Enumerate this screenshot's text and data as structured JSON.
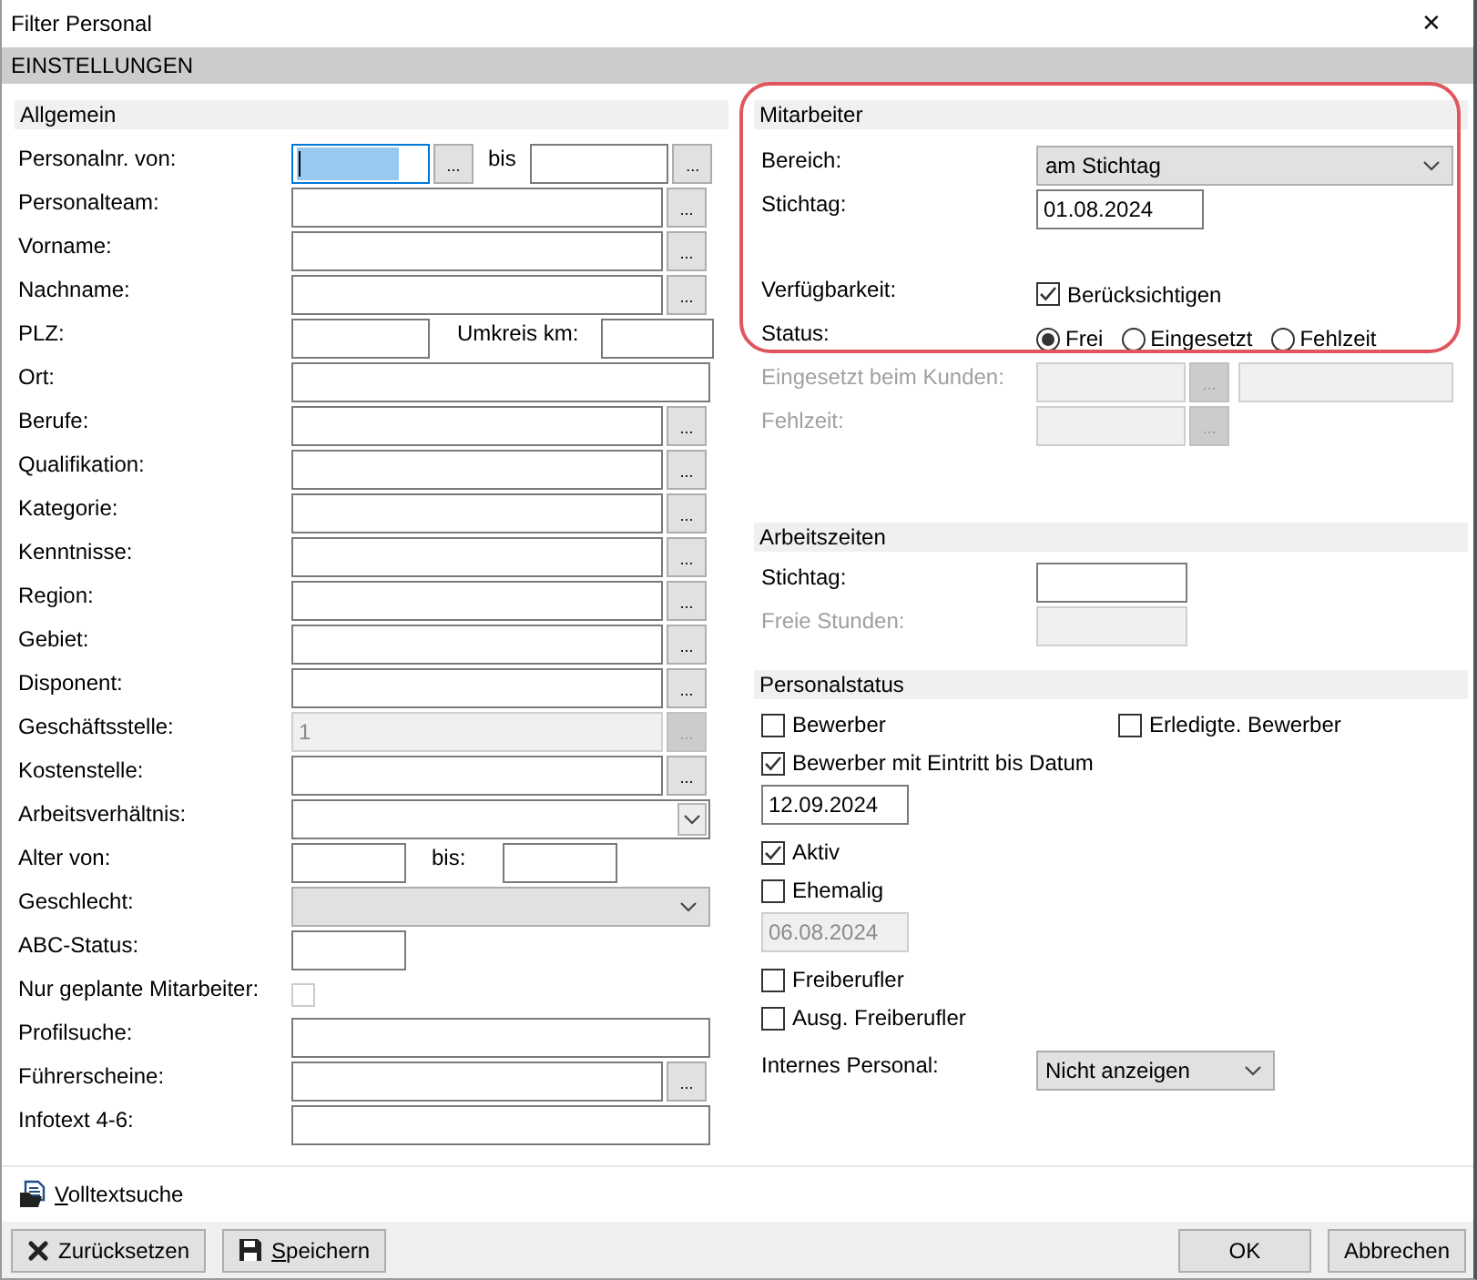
{
  "window": {
    "title": "Filter Personal",
    "close": "✕"
  },
  "header": "EINSTELLUNGEN",
  "allgemein": {
    "title": "Allgemein",
    "rows": [
      {
        "kind": "range",
        "label": "Personalnr. von:",
        "from": {
          "focused": true
        },
        "button": "...",
        "to_label": "bis",
        "to_button": "..."
      },
      {
        "kind": "lookup",
        "label": "Personalteam:",
        "button": "...",
        "disabled": false
      },
      {
        "kind": "lookup",
        "label": "Vorname:",
        "button": "...",
        "disabled": false
      },
      {
        "kind": "lookup",
        "label": "Nachname:",
        "button": "...",
        "disabled": false
      },
      {
        "kind": "pair",
        "label": "PLZ:",
        "mid_label": "Umkreis km:"
      },
      {
        "kind": "text",
        "label": "Ort:"
      },
      {
        "kind": "lookup",
        "label": "Berufe:",
        "button": "...",
        "disabled": false
      },
      {
        "kind": "lookup",
        "label": "Qualifikation:",
        "button": "...",
        "disabled": false
      },
      {
        "kind": "lookup",
        "label": "Kategorie:",
        "button": "...",
        "disabled": false
      },
      {
        "kind": "lookup",
        "label": "Kenntnisse:",
        "button": "...",
        "disabled": false
      },
      {
        "kind": "lookup",
        "label": "Region:",
        "button": "...",
        "disabled": false
      },
      {
        "kind": "lookup",
        "label": "Gebiet:",
        "button": "...",
        "disabled": false
      },
      {
        "kind": "lookup",
        "label": "Disponent:",
        "button": "...",
        "disabled": false
      },
      {
        "kind": "lookup",
        "label": "Geschäftsstelle:",
        "value": "1",
        "button": "...",
        "disabled": true
      },
      {
        "kind": "lookup",
        "label": "Kostenstelle:",
        "button": "...",
        "disabled": false
      },
      {
        "kind": "select",
        "label": "Arbeitsverhältnis:",
        "editable": true
      },
      {
        "kind": "age",
        "label": "Alter von:",
        "mid_label": "bis:"
      },
      {
        "kind": "select",
        "label": "Geschlecht:",
        "editable": false
      },
      {
        "kind": "short",
        "label": "ABC-Status:"
      },
      {
        "kind": "check",
        "label": "Nur geplante Mitarbeiter:",
        "checked": false,
        "disabled": true
      },
      {
        "kind": "text",
        "label": "Profilsuche:"
      },
      {
        "kind": "lookup",
        "label": "Führerscheine:",
        "button": "...",
        "disabled": false
      },
      {
        "kind": "text",
        "label": "Infotext 4-6:"
      }
    ]
  },
  "mitarbeiter": {
    "title": "Mitarbeiter",
    "highlighted": true,
    "rows": [
      {
        "kind": "select",
        "label": "Bereich:",
        "value": "am Stichtag",
        "editable": false
      },
      {
        "kind": "date",
        "label": "Stichtag:",
        "value": "01.08.2024",
        "disabled": false
      },
      {
        "kind": "check",
        "label": "Verfügbarkeit:",
        "text": "Berücksichtigen",
        "checked": true
      },
      {
        "kind": "radios",
        "label": "Status:",
        "options": [
          {
            "label": "Frei",
            "selected": true
          },
          {
            "label": "Eingesetzt",
            "selected": false
          },
          {
            "label": "Fehlzeit",
            "selected": false
          }
        ]
      },
      {
        "kind": "lookup2",
        "label": "Eingesetzt beim Kunden:",
        "button": "...",
        "disabled": true
      },
      {
        "kind": "lookup",
        "label": "Fehlzeit:",
        "button": "...",
        "disabled": true
      }
    ]
  },
  "arbeitszeiten": {
    "title": "Arbeitszeiten",
    "rows": [
      {
        "kind": "date",
        "label": "Stichtag:",
        "disabled": false
      },
      {
        "kind": "date",
        "label": "Freie Stunden:",
        "disabled": true
      }
    ]
  },
  "personalstatus": {
    "title": "Personalstatus",
    "items": [
      {
        "kind": "pair",
        "items": [
          {
            "label": "Bewerber",
            "checked": false
          },
          {
            "label": "Erledigte. Bewerber",
            "checked": false
          }
        ]
      },
      {
        "kind": "check",
        "label": "Bewerber mit Eintritt bis Datum",
        "checked": true
      },
      {
        "kind": "date",
        "value": "12.09.2024",
        "disabled": false
      },
      {
        "kind": "check",
        "label": "Aktiv",
        "checked": true
      },
      {
        "kind": "check",
        "label": "Ehemalig",
        "checked": false
      },
      {
        "kind": "date",
        "value": "06.08.2024",
        "disabled": true
      },
      {
        "kind": "check",
        "label": "Freiberufler",
        "checked": false
      },
      {
        "kind": "check",
        "label": "Ausg. Freiberufler",
        "checked": false
      },
      {
        "kind": "select",
        "label": "Internes Personal:",
        "value": "Nicht anzeigen",
        "editable": false
      }
    ]
  },
  "fulltext_link": {
    "label": "Volltextsuche",
    "mnemonic": true
  },
  "buttons_left": [
    {
      "label": "Zurücksetzen",
      "kind": "reset",
      "mnemonic": false
    },
    {
      "label": "Speichern",
      "kind": "save",
      "mnemonic": true
    }
  ],
  "buttons_right": [
    {
      "label": "OK"
    },
    {
      "label": "Abbrechen"
    }
  ]
}
